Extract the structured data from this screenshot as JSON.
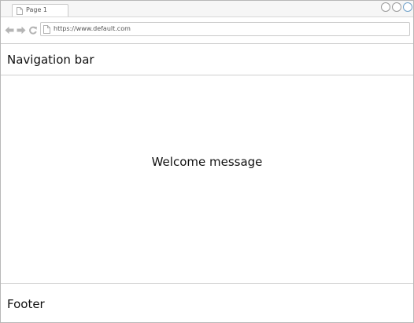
{
  "browser": {
    "tab": {
      "label": "Page 1",
      "icon": "document-icon"
    },
    "address_bar": {
      "url": "https://www.default.com",
      "icon": "document-icon"
    },
    "nav_icons": [
      "back-arrow-icon",
      "forward-arrow-icon",
      "reload-icon"
    ],
    "window_controls": [
      "minimize-control",
      "maximize-control",
      "close-control"
    ]
  },
  "page": {
    "navbar": {
      "text": "Navigation bar"
    },
    "main": {
      "text": "Welcome message"
    },
    "footer": {
      "text": "Footer"
    }
  },
  "colors": {
    "border": "#b8b8b8",
    "divider": "#cfcfcf",
    "text": "#111111",
    "control_accent": "#6fa1c9"
  }
}
